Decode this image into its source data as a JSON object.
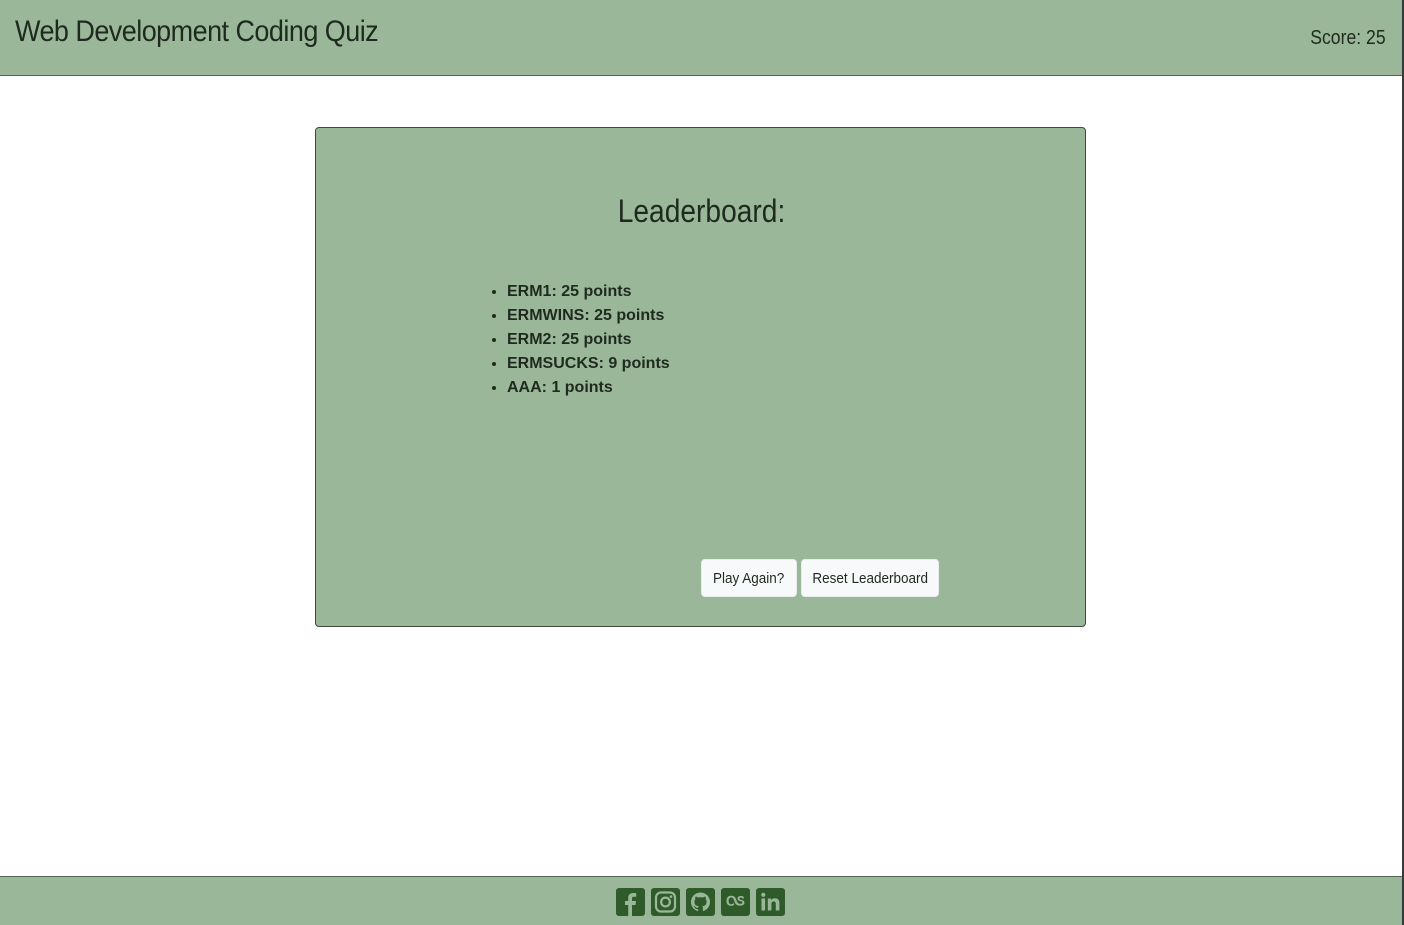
{
  "header": {
    "title": "Web Development Coding Quiz",
    "score_text": "Score: 25"
  },
  "leaderboard": {
    "title": "Leaderboard:",
    "entries": [
      "ERM1: 25 points",
      "ERMWINS: 25 points",
      "ERM2: 25 points",
      "ERMSUCKS: 9 points",
      "AAA: 1 points"
    ],
    "play_again_label": "Play Again?",
    "reset_label": "Reset Leaderboard"
  },
  "footer": {
    "social_icons": [
      "facebook-icon",
      "instagram-icon",
      "github-icon",
      "lastfm-icon",
      "linkedin-icon"
    ]
  },
  "colors": {
    "panel_green": "#9ab899",
    "icon_green": "#2f5a2a",
    "text_dark": "#1f2a1f"
  }
}
